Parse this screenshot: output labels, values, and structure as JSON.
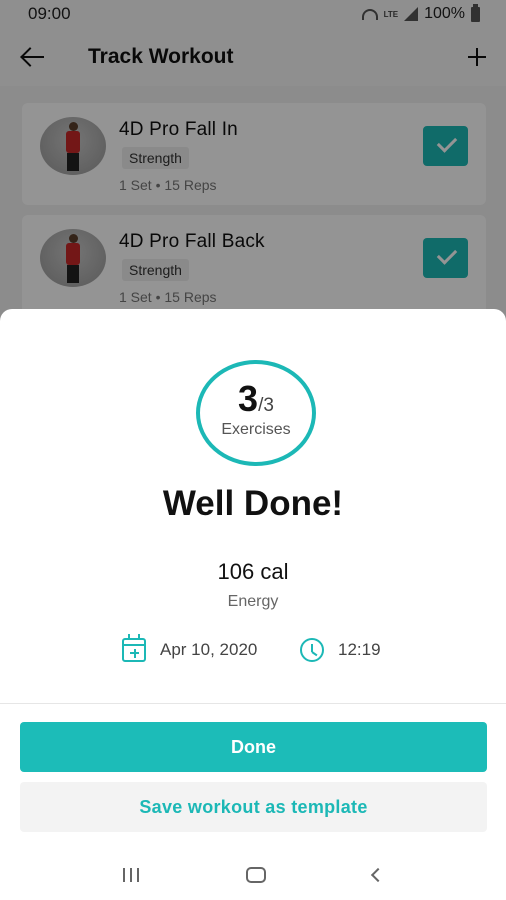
{
  "status_bar": {
    "time": "09:00",
    "network": "LTE",
    "battery": "100%"
  },
  "app_bar": {
    "title": "Track Workout",
    "back_icon": "arrow-left-icon",
    "add_icon": "plus-icon"
  },
  "exercises": [
    {
      "name": "4D Pro Fall In",
      "category": "Strength",
      "details": "1 Set • 15 Reps",
      "checked": true
    },
    {
      "name": "4D Pro Fall Back",
      "category": "Strength",
      "details": "1 Set • 15 Reps",
      "checked": true
    }
  ],
  "summary": {
    "completed": "3",
    "total": "/3",
    "completed_label": "Exercises",
    "headline": "Well Done!",
    "energy_value": "106 cal",
    "energy_label": "Energy",
    "date": "Apr 10, 2020",
    "time": "12:19"
  },
  "actions": {
    "done_label": "Done",
    "template_label": "Save workout as template"
  },
  "colors": {
    "accent": "#1cb8b6"
  }
}
